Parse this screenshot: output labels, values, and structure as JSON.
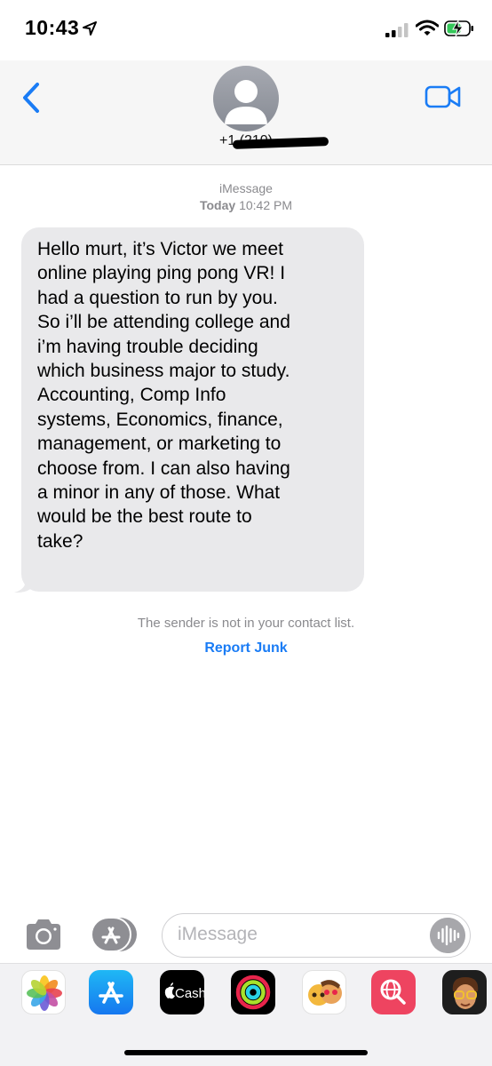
{
  "status_bar": {
    "time": "10:43"
  },
  "header": {
    "contact_number": "+1 (210)",
    "back_icon": "chevron-left-icon",
    "video_icon": "video-camera-icon"
  },
  "conversation": {
    "service_label": "iMessage",
    "timestamp_day": "Today",
    "timestamp_time": "10:42 PM",
    "message_lines": [
      "Hello murt, it’s Victor we meet",
      "online playing ping pong VR! I",
      "had a question to run by you.",
      "So i’ll be attending college and",
      "i’m having trouble deciding",
      "which business major to study.",
      "Accounting, Comp Info",
      "systems, Economics, finance,",
      "management, or marketing to",
      "choose from. I can also having",
      "a minor in any of those. What",
      "would be the best route to",
      "take?"
    ],
    "not_in_contacts": "The sender is not in your contact list.",
    "report_junk": "Report Junk"
  },
  "input_bar": {
    "placeholder": "iMessage"
  },
  "app_drawer": {
    "cash_label": "Cash",
    "apps": [
      "photos-icon",
      "app-store-icon",
      "apple-cash-icon",
      "activity-icon",
      "memoji-stickers-icon",
      "web-images-icon",
      "memoji-icon"
    ]
  },
  "colors": {
    "accent": "#1a7cf5",
    "bubble": "#e9e9eb",
    "secondary_text": "#8a8a8e"
  }
}
